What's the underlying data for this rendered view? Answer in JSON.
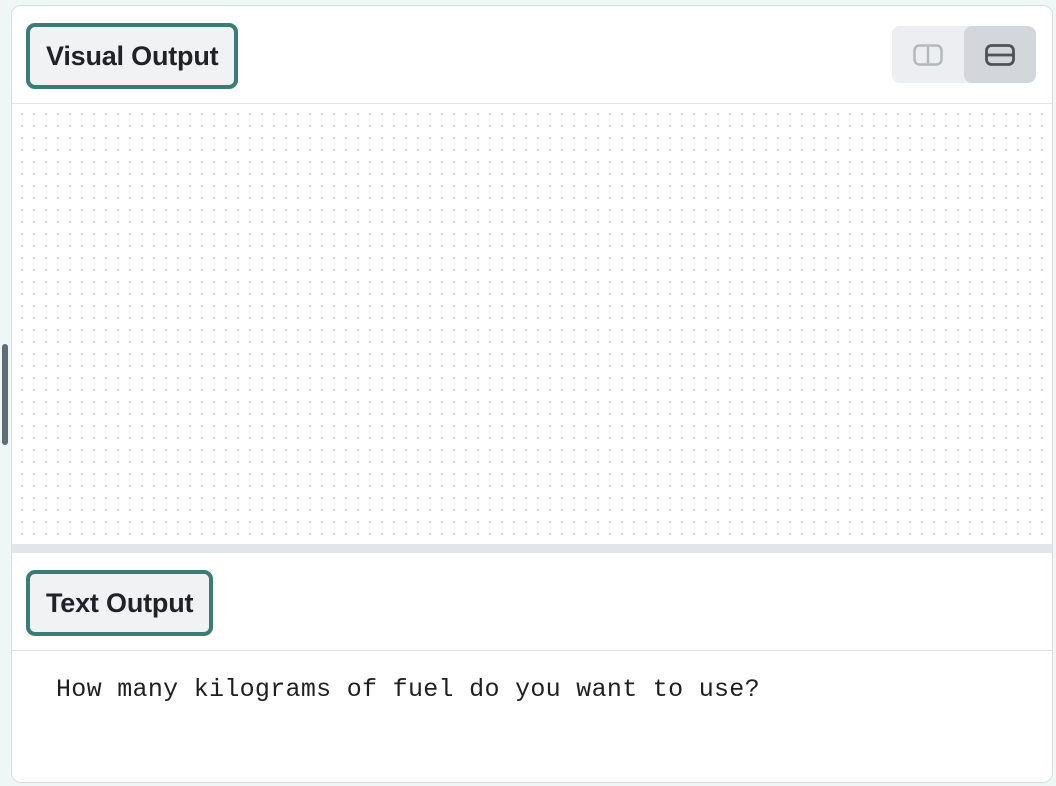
{
  "visual_output": {
    "title": "Visual Output",
    "layout_toggle": {
      "options": [
        {
          "icon": "split-columns-icon",
          "active": false
        },
        {
          "icon": "split-rows-icon",
          "active": true
        }
      ]
    }
  },
  "text_output": {
    "title": "Text Output",
    "lines": [
      "How many kilograms of fuel do you want to use?"
    ]
  },
  "colors": {
    "accent_border": "#3a7d77",
    "page_background": "#eef7f6",
    "active_toggle": "#d3d6db"
  }
}
